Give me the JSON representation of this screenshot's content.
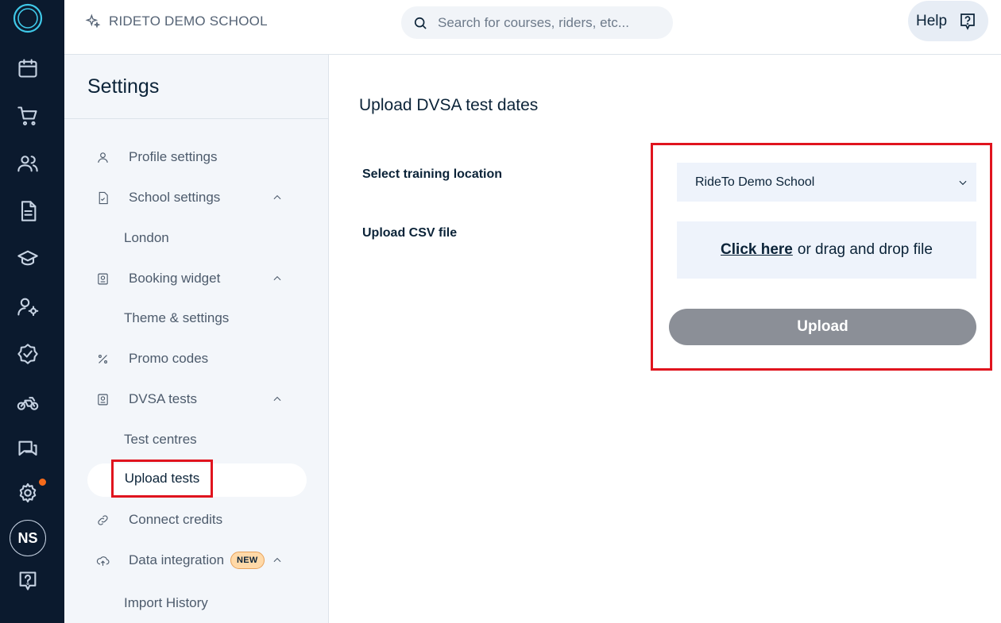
{
  "header": {
    "school_name": "RIDETO DEMO SCHOOL",
    "search_placeholder": "Search for courses, riders, etc...",
    "help_label": "Help"
  },
  "rail": {
    "avatar_initials": "NS",
    "items": [
      "calendar-icon",
      "cart-icon",
      "users-icon",
      "document-icon",
      "graduation-cap-icon",
      "user-settings-icon",
      "badge-check-icon",
      "motorbike-icon",
      "chat-icon",
      "settings-icon",
      "help-icon"
    ],
    "notification_color": "#f56a1a"
  },
  "sidebar": {
    "title": "Settings",
    "items": {
      "profile": "Profile settings",
      "school": "School settings",
      "school_sub": "London",
      "widget": "Booking widget",
      "widget_sub": "Theme & settings",
      "promo": "Promo codes",
      "dvsa": "DVSA tests",
      "dvsa_sub1": "Test centres",
      "dvsa_sub2": "Upload tests",
      "credits": "Connect credits",
      "data": "Data integration",
      "data_badge": "NEW",
      "data_sub": "Import History"
    }
  },
  "main": {
    "title": "Upload DVSA test dates",
    "location_label": "Select training location",
    "location_value": "RideTo Demo School",
    "csv_label": "Upload CSV file",
    "drop_link": "Click here",
    "drop_text": "or drag and drop file",
    "upload_button": "Upload"
  },
  "colors": {
    "rail_bg": "#0b1a2e",
    "sidebar_bg": "#f3f6fa",
    "highlight_red": "#e0141e",
    "button_disabled": "#8b8f97"
  }
}
